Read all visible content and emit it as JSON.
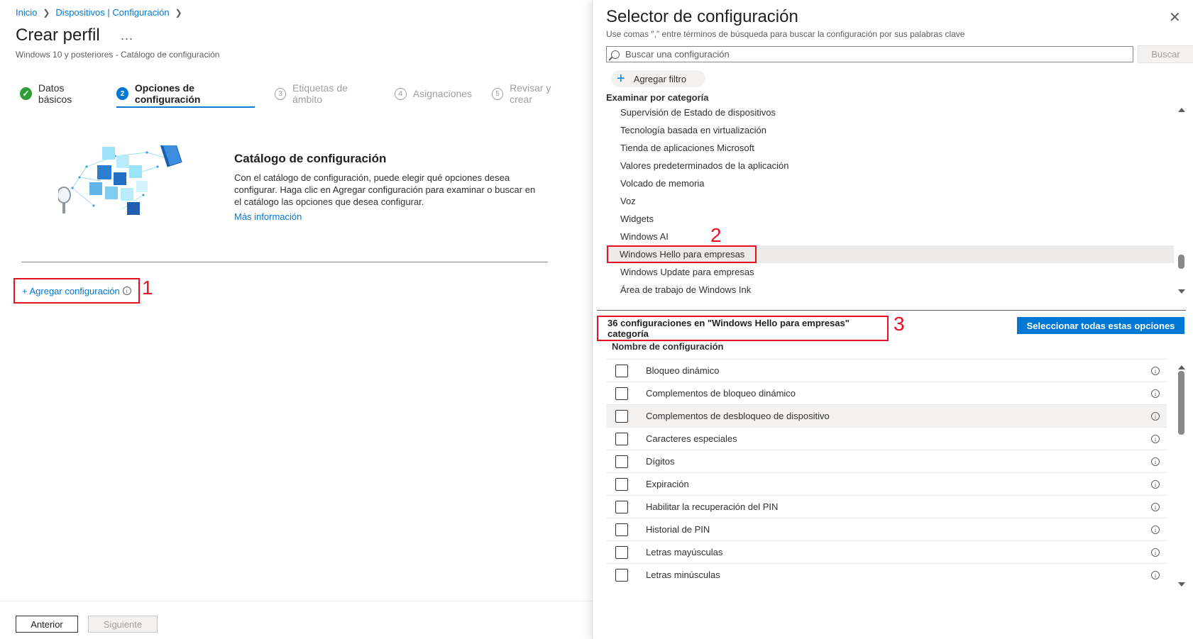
{
  "breadcrumb": {
    "items": [
      "Inicio",
      "Dispositivos | Configuración"
    ]
  },
  "page": {
    "title": "Crear perfil",
    "more": "...",
    "subtitle": "Windows 10 y posteriores - Catálogo de configuración"
  },
  "tabs": [
    {
      "label": "Datos básicos",
      "step": "✓",
      "state": "done"
    },
    {
      "label": "Opciones de configuración",
      "step": "2",
      "state": "current"
    },
    {
      "label": "Etiquetas de ámbito",
      "step": "3",
      "state": "pending"
    },
    {
      "label": "Asignaciones",
      "step": "4",
      "state": "pending"
    },
    {
      "label": "Revisar y crear",
      "step": "5",
      "state": "pending"
    }
  ],
  "catalog": {
    "title": "Catálogo de configuración",
    "description": "Con el catálogo de configuración, puede elegir qué opciones desea configurar. Haga clic en Agregar configuración para examinar o buscar en el catálogo las opciones que desea configurar.",
    "link": "Más información"
  },
  "add_config": {
    "label": "+ Agregar configuración",
    "info": "i"
  },
  "markers": {
    "one": "1",
    "two": "2",
    "three": "3"
  },
  "footer": {
    "prev": "Anterior",
    "next": "Siguiente"
  },
  "picker": {
    "title": "Selector de configuración",
    "close": "✕",
    "help": "Use comas \",\" entre términos de búsqueda para buscar la configuración por sus palabras clave",
    "search_placeholder": "Buscar una configuración",
    "search_value": "",
    "search_button": "Buscar",
    "add_filter": "Agregar filtro",
    "add_filter_icon": "+",
    "browse_label": "Examinar por categoría",
    "categories": [
      "Supervisión de Estado de dispositivos",
      "Tecnología basada en virtualización",
      "Tienda de aplicaciones Microsoft",
      "Valores predeterminados de la aplicación",
      "Volcado de memoria",
      "Voz",
      "Widgets",
      "Windows AI",
      "Windows Hello para empresas",
      "Windows Update para empresas",
      "Área de trabajo de Windows Ink"
    ],
    "selected_category_index": 8,
    "category_scroll_thumb_position": 0.88,
    "count_text": "36 configuraciones en \"Windows Hello para empresas\" categoría",
    "select_all": "Seleccionar todas estas opciones",
    "column_header": "Nombre de configuración",
    "settings": [
      "Bloqueo dinámico",
      "Complementos de bloqueo dinámico",
      "Complementos de desbloqueo de dispositivo",
      "Caracteres especiales",
      "Dígitos",
      "Expiración",
      "Habilitar la recuperación del PIN",
      "Historial de PIN",
      "Letras mayúsculas",
      "Letras minúsculas"
    ],
    "hovered_setting_index": 2,
    "settings_scroll_thumb_position": 0.0
  },
  "colors": {
    "accent": "#0078d4",
    "highlight_box": "#e81123",
    "success": "#2e9e36"
  }
}
